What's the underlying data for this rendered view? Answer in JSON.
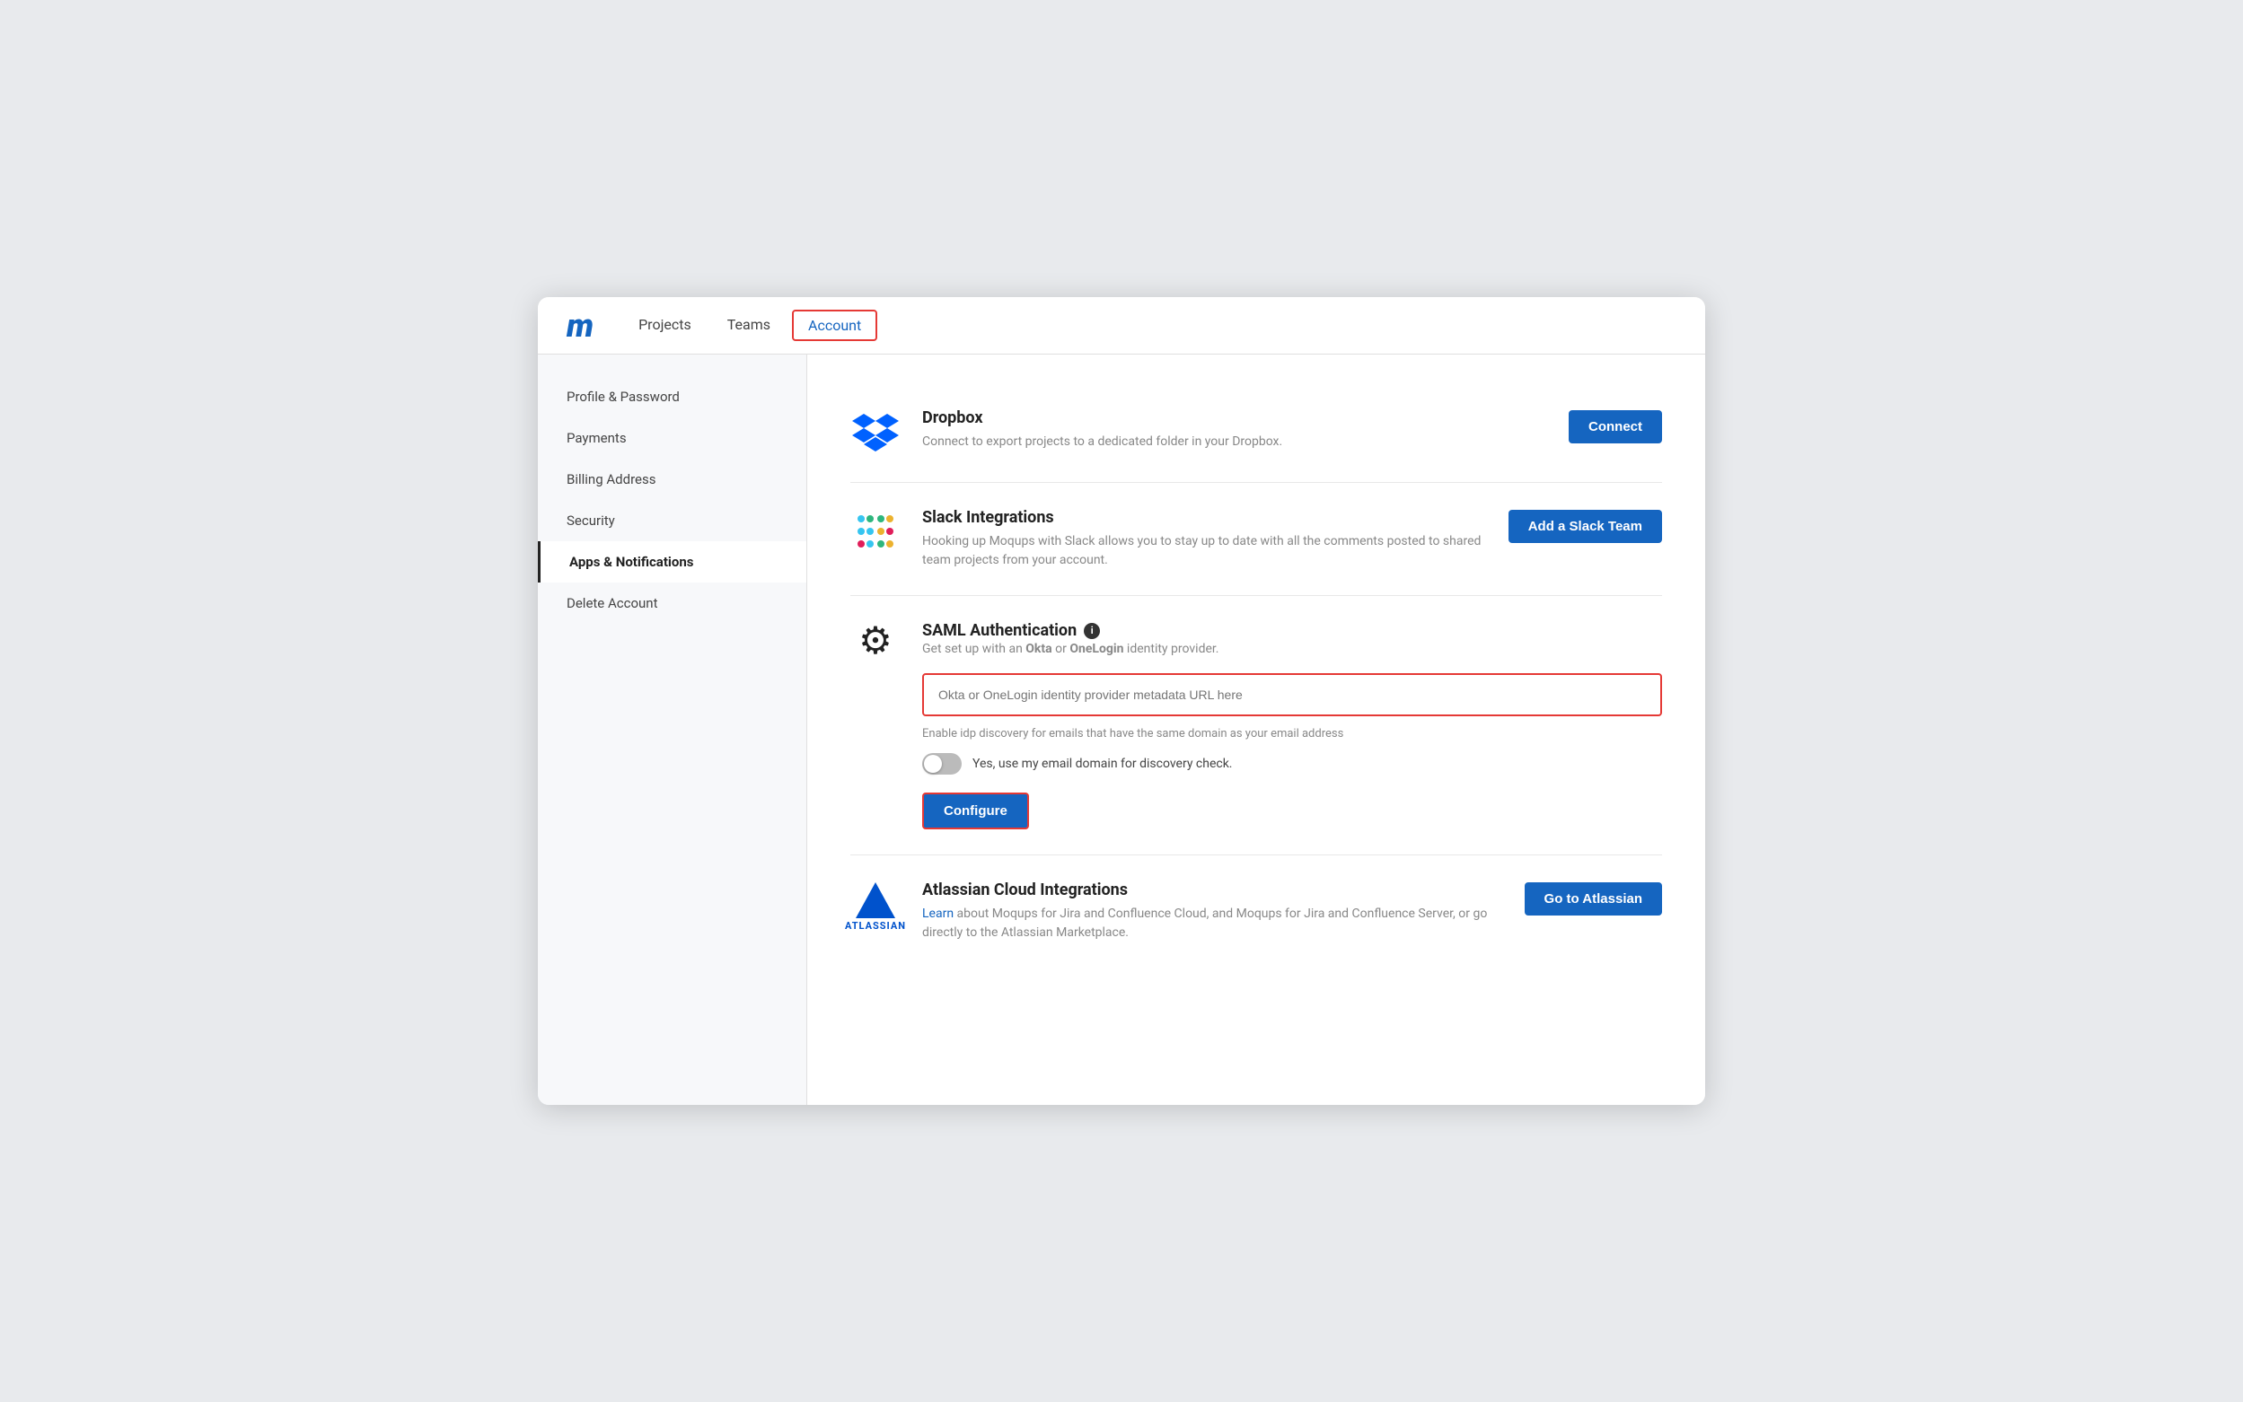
{
  "app": {
    "logo": "m",
    "nav": {
      "items": [
        {
          "label": "Projects",
          "active": false
        },
        {
          "label": "Teams",
          "active": false
        },
        {
          "label": "Account",
          "active": true
        }
      ]
    }
  },
  "sidebar": {
    "items": [
      {
        "label": "Profile & Password",
        "active": false
      },
      {
        "label": "Payments",
        "active": false
      },
      {
        "label": "Billing Address",
        "active": false
      },
      {
        "label": "Security",
        "active": false
      },
      {
        "label": "Apps & Notifications",
        "active": true
      },
      {
        "label": "Delete Account",
        "active": false
      }
    ]
  },
  "main": {
    "integrations": [
      {
        "id": "dropbox",
        "title": "Dropbox",
        "description": "Connect to export projects to a dedicated folder in your Dropbox.",
        "button_label": "Connect"
      },
      {
        "id": "slack",
        "title": "Slack Integrations",
        "description": "Hooking up Moqups with Slack allows you to stay up to date with all the comments posted to shared team projects from your account.",
        "button_label": "Add a Slack Team"
      }
    ],
    "saml": {
      "title": "SAML Authentication",
      "description": "Get set up with an Okta or OneLogin identity provider.",
      "input_placeholder": "Okta or OneLogin identity provider metadata URL here",
      "hint": "Enable idp discovery for emails that have the same domain as your email address",
      "toggle_label": "Yes, use my email domain for discovery check.",
      "button_label": "Configure"
    },
    "atlassian": {
      "id": "atlassian",
      "title": "Atlassian Cloud Integrations",
      "description_parts": {
        "learn": "Learn",
        "rest": " about Moqups for Jira and Confluence Cloud, and Moqups for Jira and Confluence Server, or go directly to the Atlassian Marketplace."
      },
      "button_label": "Go to Atlassian"
    }
  }
}
